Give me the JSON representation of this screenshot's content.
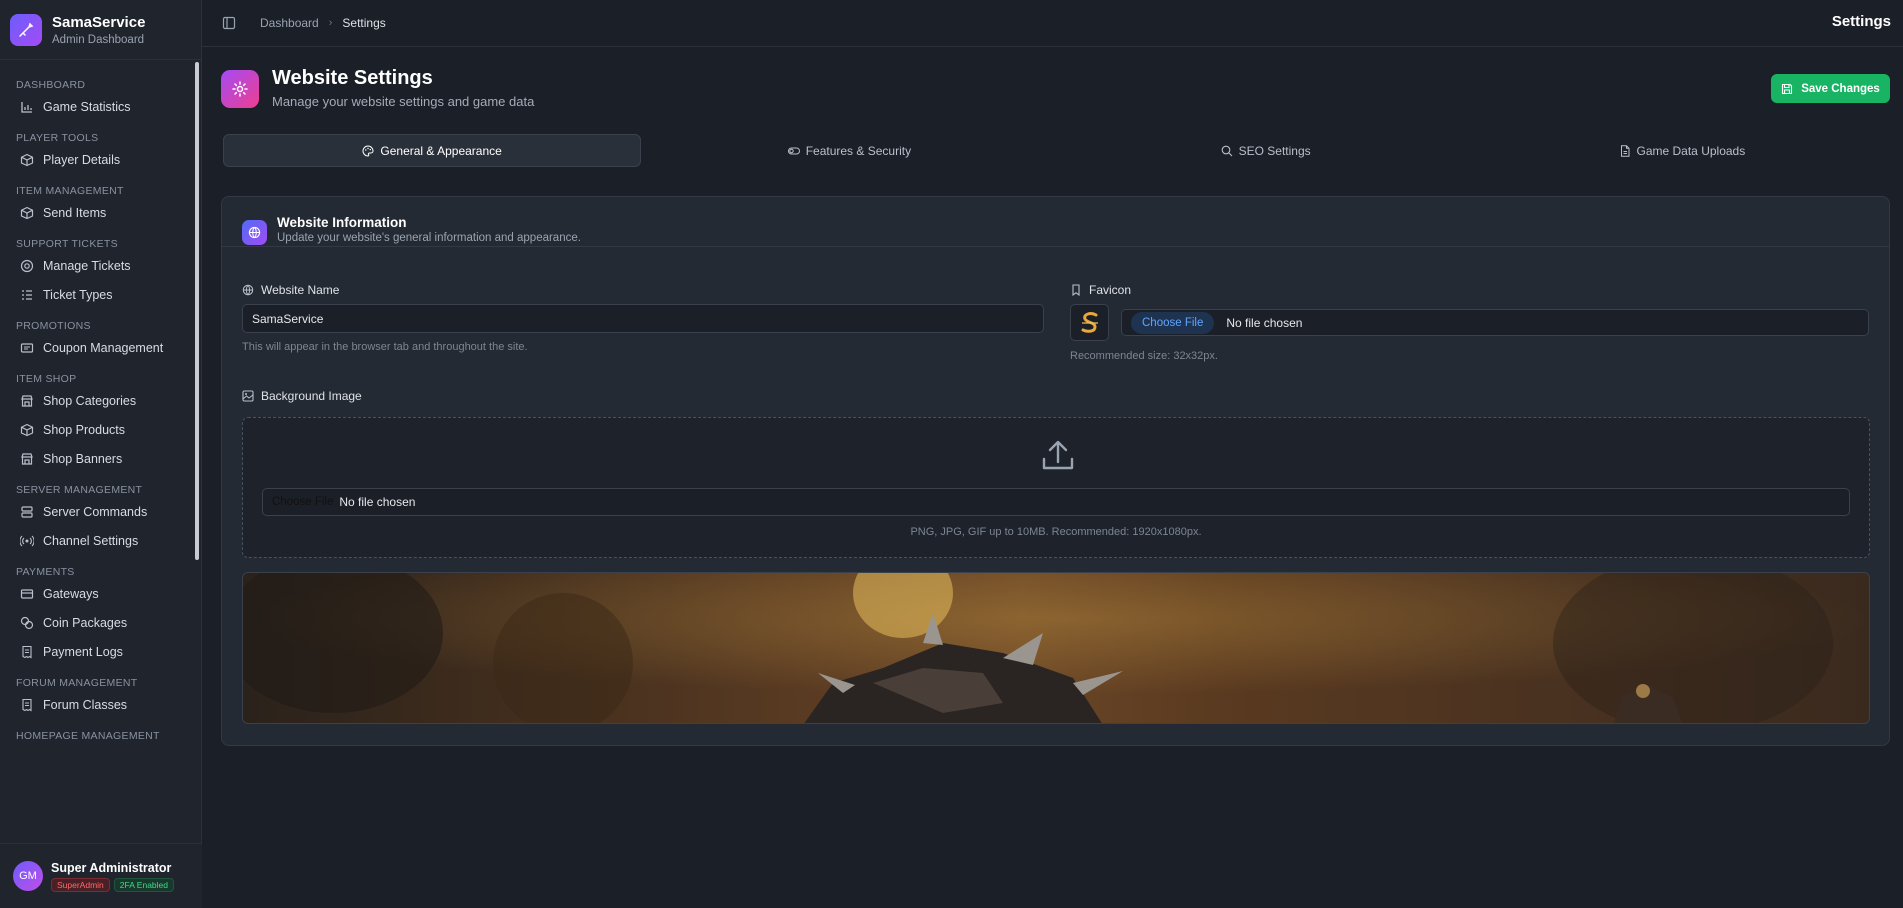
{
  "app": {
    "name": "SamaService",
    "subtitle": "Admin Dashboard"
  },
  "sidebar": {
    "sections": [
      {
        "title": "DASHBOARD",
        "items": [
          {
            "label": "Game Statistics",
            "icon": "bar-chart-icon"
          }
        ]
      },
      {
        "title": "PLAYER TOOLS",
        "items": [
          {
            "label": "Player Details",
            "icon": "cube-icon"
          }
        ]
      },
      {
        "title": "ITEM MANAGEMENT",
        "items": [
          {
            "label": "Send Items",
            "icon": "cube-icon"
          }
        ]
      },
      {
        "title": "SUPPORT TICKETS",
        "items": [
          {
            "label": "Manage Tickets",
            "icon": "help-circle-icon"
          },
          {
            "label": "Ticket Types",
            "icon": "list-icon"
          }
        ]
      },
      {
        "title": "PROMOTIONS",
        "items": [
          {
            "label": "Coupon Management",
            "icon": "ticket-icon"
          }
        ]
      },
      {
        "title": "ITEM SHOP",
        "items": [
          {
            "label": "Shop Categories",
            "icon": "store-icon"
          },
          {
            "label": "Shop Products",
            "icon": "cube-icon"
          },
          {
            "label": "Shop Banners",
            "icon": "store-icon"
          }
        ]
      },
      {
        "title": "SERVER MANAGEMENT",
        "items": [
          {
            "label": "Server Commands",
            "icon": "server-icon"
          },
          {
            "label": "Channel Settings",
            "icon": "radio-icon"
          }
        ]
      },
      {
        "title": "PAYMENTS",
        "items": [
          {
            "label": "Gateways",
            "icon": "credit-card-icon"
          },
          {
            "label": "Coin Packages",
            "icon": "coins-icon"
          },
          {
            "label": "Payment Logs",
            "icon": "receipt-icon"
          }
        ]
      },
      {
        "title": "FORUM MANAGEMENT",
        "items": [
          {
            "label": "Forum Classes",
            "icon": "receipt-icon"
          }
        ]
      },
      {
        "title": "HOMEPAGE MANAGEMENT",
        "items": []
      }
    ]
  },
  "user": {
    "initials": "GM",
    "name": "Super Administrator",
    "role_badge": "SuperAdmin",
    "tfa_badge": "2FA Enabled"
  },
  "topbar": {
    "breadcrumb_home": "Dashboard",
    "breadcrumb_current": "Settings",
    "title": "Settings"
  },
  "page": {
    "title": "Website Settings",
    "subtitle": "Manage your website settings and game data",
    "save_label": "Save Changes"
  },
  "tabs": [
    {
      "label": "General & Appearance",
      "icon": "palette-icon",
      "active": true
    },
    {
      "label": "Features & Security",
      "icon": "toggle-icon",
      "active": false
    },
    {
      "label": "SEO Settings",
      "icon": "search-icon",
      "active": false
    },
    {
      "label": "Game Data Uploads",
      "icon": "file-icon",
      "active": false
    }
  ],
  "card": {
    "title": "Website Information",
    "subtitle": "Update your website's general information and appearance.",
    "website_name": {
      "label": "Website Name",
      "value": "SamaService",
      "hint": "This will appear in the browser tab and throughout the site."
    },
    "favicon": {
      "label": "Favicon",
      "choose_label": "Choose File",
      "file_status": "No file chosen",
      "hint": "Recommended size: 32x32px."
    },
    "background": {
      "label": "Background Image",
      "choose_label": "Choose File",
      "file_status": "No file chosen",
      "hint": "PNG, JPG, GIF up to 10MB. Recommended: 1920x1080px."
    }
  },
  "colors": {
    "accent_green": "#18b464",
    "brand_purple": "#6d5dfc",
    "page_icon_pink": "#ef3e8f"
  }
}
